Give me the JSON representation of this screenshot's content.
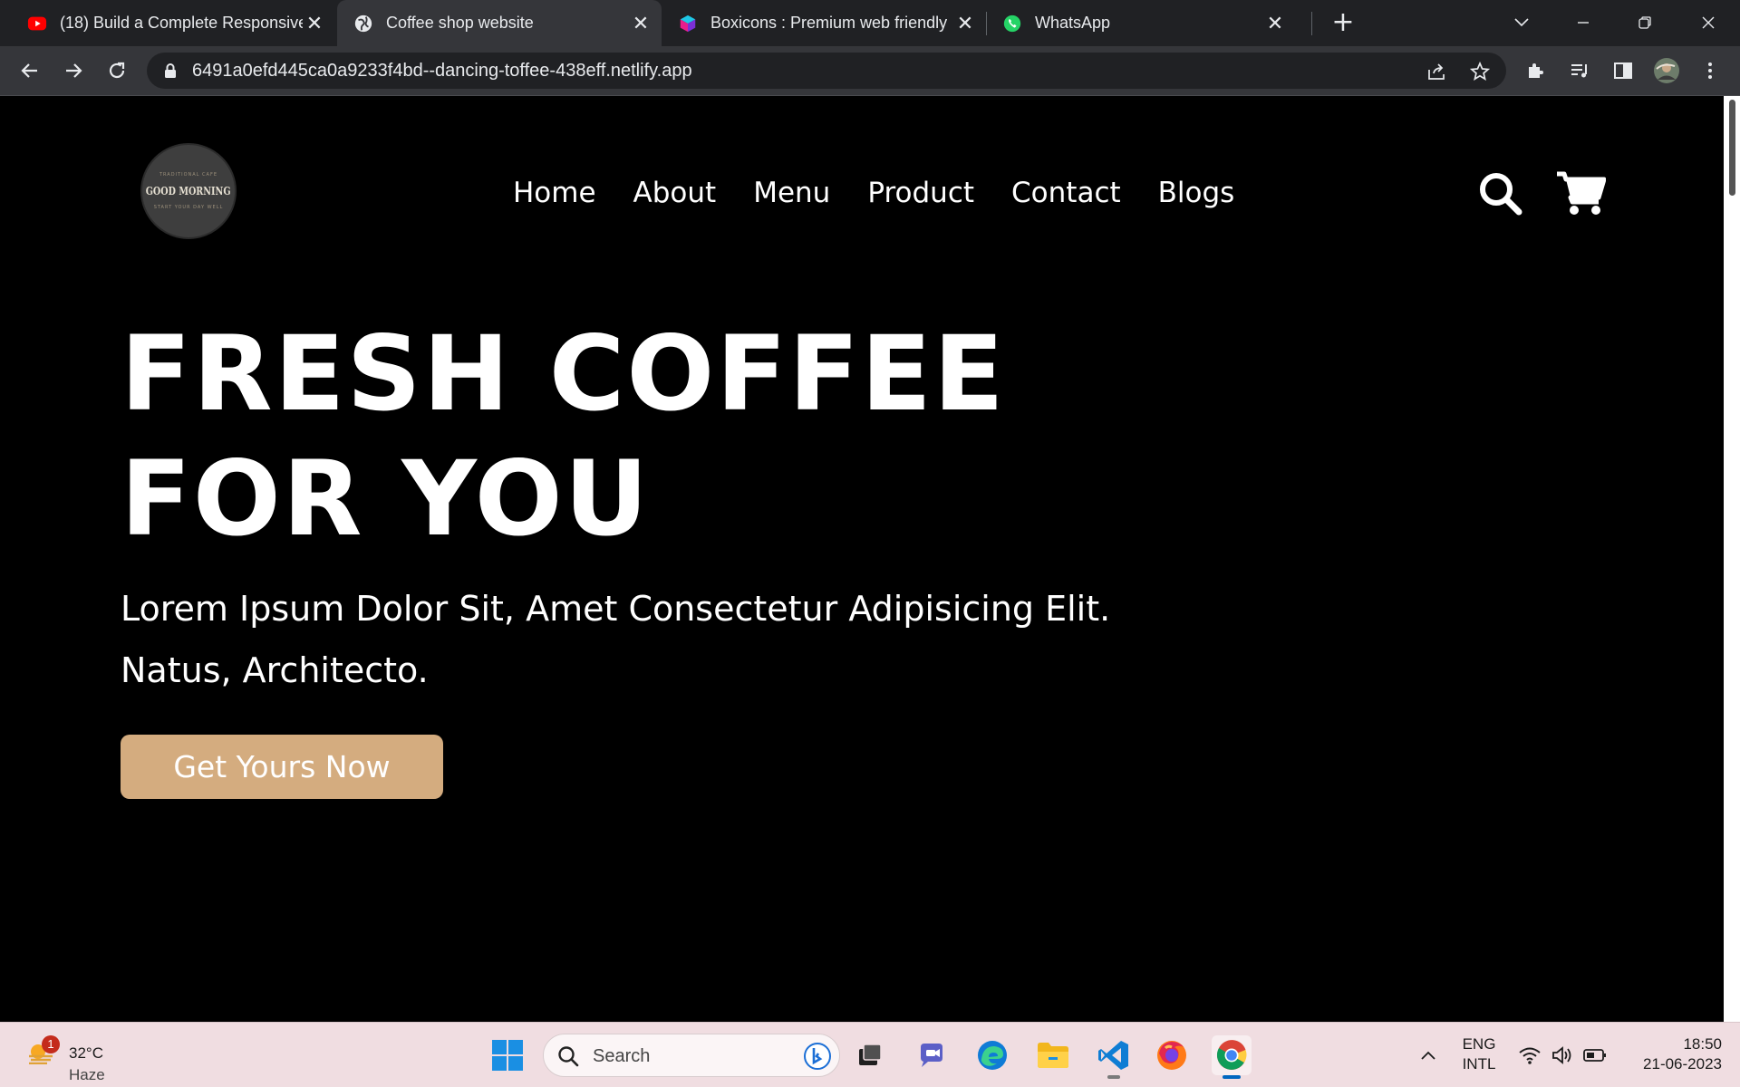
{
  "browser": {
    "tabs": [
      {
        "title": "(18) Build a Complete Responsive",
        "icon": "youtube-icon",
        "active": false
      },
      {
        "title": "Coffee shop website",
        "icon": "globe-icon",
        "active": true
      },
      {
        "title": "Boxicons : Premium web friendly",
        "icon": "boxicons-icon",
        "active": false
      },
      {
        "title": "WhatsApp",
        "icon": "whatsapp-icon",
        "active": false
      }
    ],
    "close_glyph": "✕",
    "new_tab_glyph": "+",
    "url": "6491a0efd445ca0a9233f4bd--dancing-toffee-438eff.netlify.app"
  },
  "site": {
    "logo": {
      "top_text": "TRADITIONAL CAFE",
      "main_text": "GOOD MORNING",
      "bottom_text": "START YOUR DAY WELL"
    },
    "nav": [
      "Home",
      "About",
      "Menu",
      "Product",
      "Contact",
      "Blogs"
    ],
    "hero": {
      "title_line1": "FRESH COFFEE",
      "title_line2": "FOR YOU",
      "text_line1": "Lorem Ipsum Dolor Sit, Amet Consectetur Adipisicing Elit.",
      "text_line2": "Natus, Architecto.",
      "cta": "Get Yours Now"
    },
    "colors": {
      "background": "#000000",
      "text": "#ffffff",
      "accent": "#d4ac7f"
    }
  },
  "taskbar": {
    "weather": {
      "temp": "32°C",
      "condition": "Haze",
      "badge": "1"
    },
    "search_placeholder": "Search",
    "apps": [
      "windows-start-icon",
      "task-view-icon",
      "teams-chat-icon",
      "edge-icon",
      "file-explorer-icon",
      "vscode-icon",
      "firefox-icon",
      "chrome-icon"
    ],
    "lang_line1": "ENG",
    "lang_line2": "INTL",
    "time": "18:50",
    "date": "21-06-2023"
  }
}
